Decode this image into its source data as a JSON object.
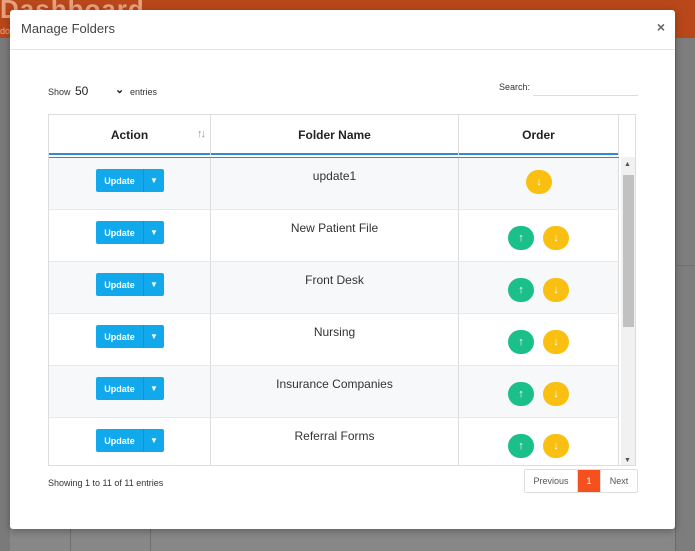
{
  "background": {
    "app_title": "Dashboard",
    "app_subtitle": "do"
  },
  "modal": {
    "title": "Manage Folders",
    "close_icon": "×"
  },
  "length_control": {
    "show_label": "Show",
    "selected": "50",
    "entries_label": "entries"
  },
  "search": {
    "label": "Search:",
    "value": ""
  },
  "table": {
    "columns": [
      "Action",
      "Folder Name",
      "Order"
    ],
    "sort_icon": "↑↓",
    "rows": [
      {
        "action": "Update",
        "folder": "update1"
      },
      {
        "action": "Update",
        "folder": "New Patient File"
      },
      {
        "action": "Update",
        "folder": "Front Desk"
      },
      {
        "action": "Update",
        "folder": "Nursing"
      },
      {
        "action": "Update",
        "folder": "Insurance Companies"
      },
      {
        "action": "Update",
        "folder": "Referral Forms"
      }
    ]
  },
  "footer": {
    "info": "Showing 1 to 11 of 11 entries",
    "prev": "Previous",
    "page": "1",
    "next": "Next"
  },
  "colors": {
    "update_button": "#11a9ec",
    "order_up": "#1bbf8a",
    "order_down": "#f9c012",
    "active_page": "#f4511e",
    "header_underline": "#2e8bd6"
  }
}
